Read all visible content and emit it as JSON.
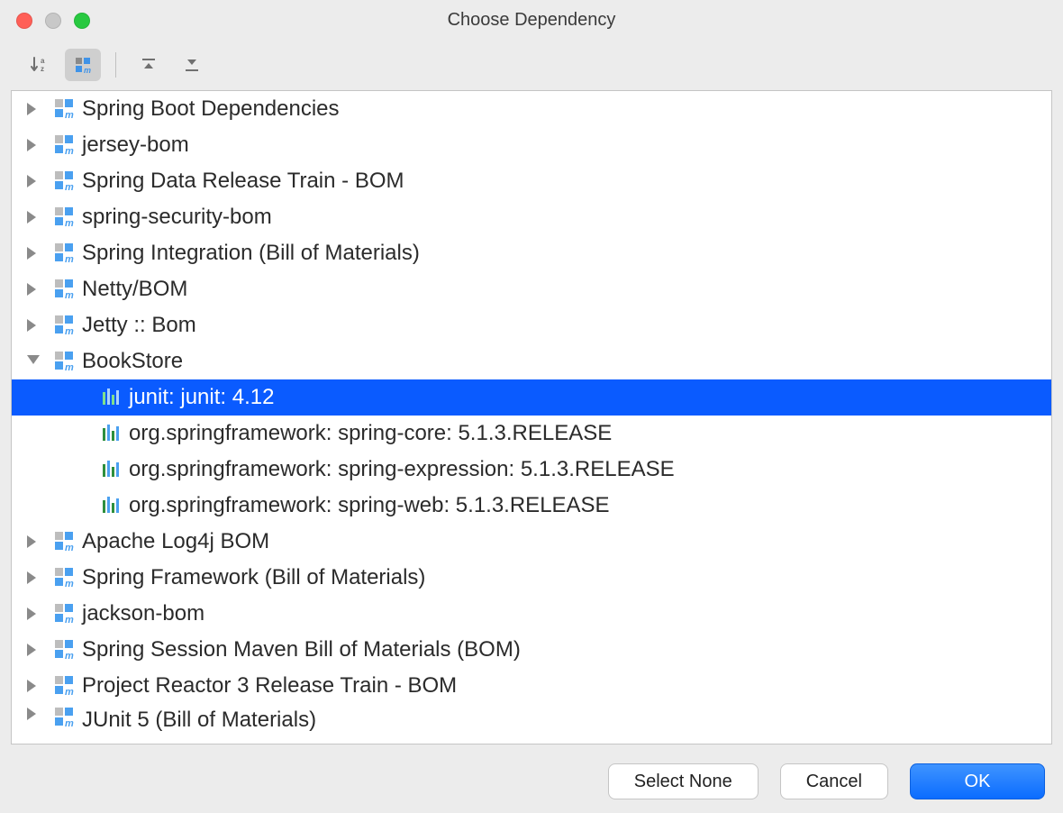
{
  "title": "Choose Dependency",
  "toolbar": {
    "sort_btn": "sort-az",
    "maven_btn": "maven-module",
    "expand_btn": "expand-all",
    "collapse_btn": "collapse-all"
  },
  "tree": [
    {
      "kind": "module",
      "expanded": false,
      "label": "Spring Boot Dependencies"
    },
    {
      "kind": "module",
      "expanded": false,
      "label": "jersey-bom"
    },
    {
      "kind": "module",
      "expanded": false,
      "label": "Spring Data Release Train - BOM"
    },
    {
      "kind": "module",
      "expanded": false,
      "label": "spring-security-bom"
    },
    {
      "kind": "module",
      "expanded": false,
      "label": "Spring Integration (Bill of Materials)"
    },
    {
      "kind": "module",
      "expanded": false,
      "label": "Netty/BOM"
    },
    {
      "kind": "module",
      "expanded": false,
      "label": "Jetty :: Bom"
    },
    {
      "kind": "module",
      "expanded": true,
      "label": "BookStore"
    },
    {
      "kind": "lib",
      "selected": true,
      "label": "junit: junit: 4.12"
    },
    {
      "kind": "lib",
      "selected": false,
      "label": "org.springframework: spring-core: 5.1.3.RELEASE"
    },
    {
      "kind": "lib",
      "selected": false,
      "label": "org.springframework: spring-expression: 5.1.3.RELEASE"
    },
    {
      "kind": "lib",
      "selected": false,
      "label": "org.springframework: spring-web: 5.1.3.RELEASE"
    },
    {
      "kind": "module",
      "expanded": false,
      "label": "Apache Log4j BOM"
    },
    {
      "kind": "module",
      "expanded": false,
      "label": "Spring Framework (Bill of Materials)"
    },
    {
      "kind": "module",
      "expanded": false,
      "label": "jackson-bom"
    },
    {
      "kind": "module",
      "expanded": false,
      "label": "Spring Session Maven Bill of Materials (BOM)"
    },
    {
      "kind": "module",
      "expanded": false,
      "label": "Project Reactor 3 Release Train - BOM"
    },
    {
      "kind": "module",
      "expanded": false,
      "label": "JUnit 5 (Bill of Materials)",
      "cutoff": true
    }
  ],
  "footer": {
    "select_none": "Select None",
    "cancel": "Cancel",
    "ok": "OK"
  }
}
